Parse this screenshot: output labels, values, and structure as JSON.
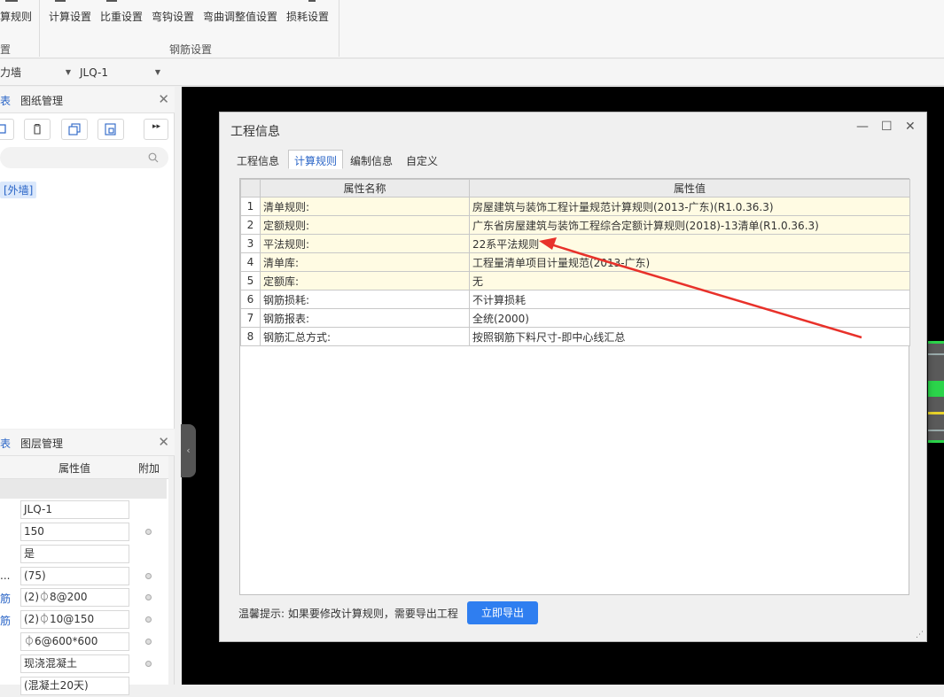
{
  "ribbon": {
    "buttons": [
      "算规则",
      "计算设置",
      "比重设置",
      "弯钩设置",
      "弯曲调整值设置",
      "损耗设置"
    ],
    "groups": [
      "置",
      "钢筋设置"
    ]
  },
  "selectors": {
    "left_value": "力墙",
    "right_value": "JLQ-1"
  },
  "drawing_panel": {
    "tabs": [
      "表",
      "图纸管理"
    ],
    "tree_item": "[外墙]"
  },
  "layer_panel": {
    "tabs": [
      "表",
      "图层管理"
    ],
    "headers": [
      "属性值",
      "附加"
    ],
    "rows": [
      {
        "label": "",
        "value": "JLQ-1",
        "dot": false
      },
      {
        "label": "",
        "value": "150",
        "dot": true
      },
      {
        "label": "",
        "value": "是",
        "dot": false
      },
      {
        "label": "...",
        "value": "(75)",
        "dot": true
      },
      {
        "label": "筋",
        "value": "(2)⏀8@200",
        "dot": true
      },
      {
        "label": "筋",
        "value": "(2)⏀10@150",
        "dot": true
      },
      {
        "label": "",
        "value": "⏀6@600*600",
        "dot": true
      },
      {
        "label": "",
        "value": "现浇混凝土",
        "dot": true
      },
      {
        "label": "",
        "value": "(混凝土20天)",
        "dot": false
      }
    ]
  },
  "dialog": {
    "title": "工程信息",
    "window_buttons": [
      "—",
      "☐",
      "✕"
    ],
    "tabs": [
      "工程信息",
      "计算规则",
      "编制信息",
      "自定义"
    ],
    "active_tab": 1,
    "table": {
      "headers": [
        "属性名称",
        "属性值"
      ],
      "rows": [
        {
          "n": "1",
          "name": "清单规则:",
          "value": "房屋建筑与装饰工程计量规范计算规则(2013-广东)(R1.0.36.3)",
          "hl": true
        },
        {
          "n": "2",
          "name": "定额规则:",
          "value": "广东省房屋建筑与装饰工程综合定额计算规则(2018)-13清单(R1.0.36.3)",
          "hl": true
        },
        {
          "n": "3",
          "name": "平法规则:",
          "value": "22系平法规则",
          "hl": true
        },
        {
          "n": "4",
          "name": "清单库:",
          "value": "工程量清单项目计量规范(2013-广东)",
          "hl": true
        },
        {
          "n": "5",
          "name": "定额库:",
          "value": "无",
          "hl": true
        },
        {
          "n": "6",
          "name": "钢筋损耗:",
          "value": "不计算损耗",
          "hl": false
        },
        {
          "n": "7",
          "name": "钢筋报表:",
          "value": "全统(2000)",
          "hl": false
        },
        {
          "n": "8",
          "name": "钢筋汇总方式:",
          "value": "按照钢筋下料尺寸-即中心线汇总",
          "hl": false
        }
      ]
    },
    "tip": "温馨提示: 如果要修改计算规则，需要导出工程",
    "export_button": "立即导出"
  },
  "colors": {
    "accent": "#2f7ef0",
    "annotation_arrow": "#e8312a",
    "highlight_row": "#fffbe3"
  },
  "icons": [
    "copy-icon",
    "delete-icon",
    "duplicate-icon",
    "layer-copy-icon",
    "more-icon",
    "search-icon",
    "close-icon",
    "collapse-icon"
  ]
}
